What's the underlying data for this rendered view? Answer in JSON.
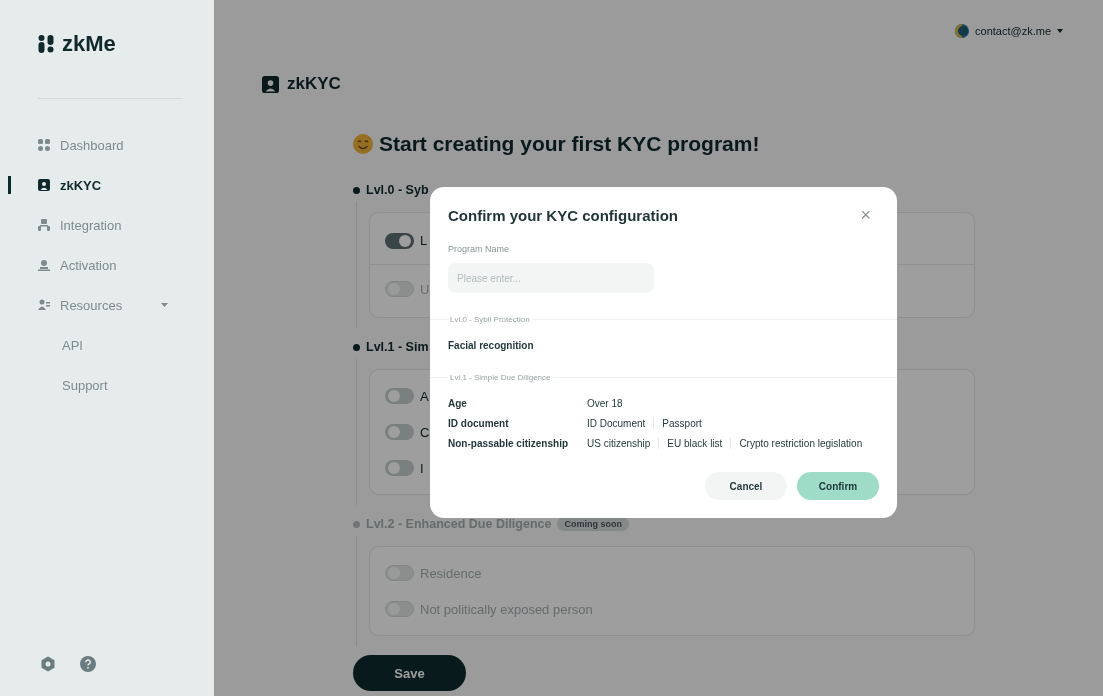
{
  "sidebar": {
    "logo": "zkMe",
    "items": [
      {
        "label": "Dashboard",
        "kind": "dashboard",
        "selected": false
      },
      {
        "label": "zkKYC",
        "kind": "kyc",
        "selected": true
      },
      {
        "label": "Integration",
        "kind": "integration",
        "selected": false
      },
      {
        "label": "Activation",
        "kind": "activation",
        "selected": false
      },
      {
        "label": "Resources",
        "kind": "resources",
        "selected": false,
        "expanded": true,
        "children": [
          {
            "label": "API",
            "selected": false
          },
          {
            "label": "Support",
            "selected": false
          }
        ]
      }
    ]
  },
  "topbar": {
    "user": "contact@zk.me"
  },
  "page": {
    "title": "zkKYC",
    "heading": "Start creating your first KYC program!",
    "sections": [
      {
        "title": "Lvl.0 - Syb",
        "disabled": false,
        "divided": true,
        "rows": [
          {
            "label": "L",
            "on": true,
            "disabled": false
          },
          {
            "label": "U",
            "on": false,
            "disabled": true
          }
        ]
      },
      {
        "title": "Lvl.1 - Sim",
        "disabled": false,
        "divided": false,
        "rows": [
          {
            "label": "A",
            "on": false,
            "disabled": false
          },
          {
            "label": "C",
            "on": false,
            "disabled": false
          },
          {
            "label": "I",
            "on": false,
            "disabled": false
          }
        ]
      },
      {
        "title": "Lvl.2 - Enhanced Due Diligence",
        "badge": "Coming soon",
        "disabled": true,
        "divided": false,
        "rows": [
          {
            "label": "Residence",
            "on": false,
            "disabled": true
          },
          {
            "label": "Not politically exposed person",
            "on": false,
            "disabled": true
          }
        ]
      }
    ],
    "save": "Save"
  },
  "modal": {
    "title": "Confirm your KYC configuration",
    "close": "×",
    "field_label": "Program Name",
    "placeholder": "Please enter...",
    "groups": [
      {
        "title": "Lvl.0 - Sybil Protection",
        "rows": [
          {
            "label": "Facial recognition",
            "values": []
          }
        ]
      },
      {
        "title": "Lvl.1 - Simple Due Diligence",
        "rows": [
          {
            "label": "Age",
            "values": [
              "Over 18"
            ]
          },
          {
            "label": "ID document",
            "values": [
              "ID Document",
              "Passport"
            ]
          },
          {
            "label": "Non-passable citizenship",
            "values": [
              "US citizenship",
              "EU black list",
              "Crypto restriction legislation"
            ]
          }
        ]
      }
    ],
    "buttons": [
      {
        "label": "Cancel",
        "kind": "secondary"
      },
      {
        "label": "Confirm",
        "kind": "primary"
      }
    ]
  }
}
